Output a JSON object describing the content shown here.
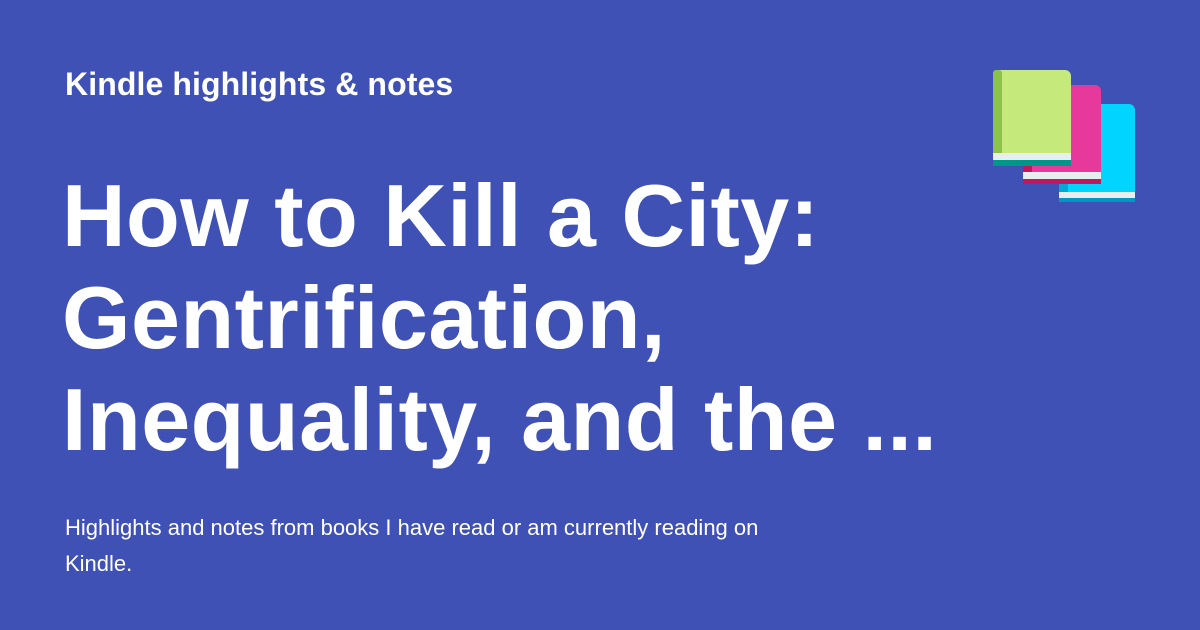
{
  "colors": {
    "background": "#3f51b5",
    "text": "#ffffff",
    "book_front": "#c5e97a",
    "book_front_spine": "#8bc34a",
    "book_middle": "#e91e63",
    "book_back": "#00d4ff",
    "page_edge": "#e8edf0",
    "page_edge_border": "#009688"
  },
  "header": {
    "eyebrow": "Kindle highlights & notes"
  },
  "main": {
    "title": "How to Kill a City: Gentrification, Inequality, and the ...",
    "description": "Highlights and notes from books I have read or am currently reading on Kindle."
  },
  "icon": {
    "name": "books-icon"
  }
}
